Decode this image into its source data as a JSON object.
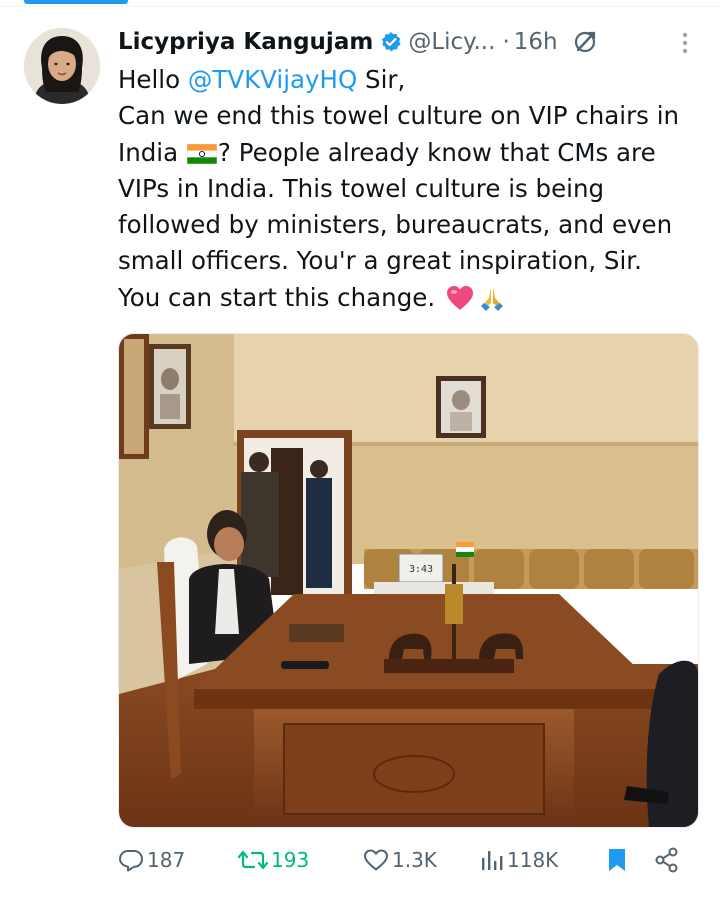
{
  "tweet": {
    "author": {
      "name": "Licypriya Kangujam",
      "handle": "@Licy...",
      "verified": true
    },
    "timestamp": "16h",
    "separator": "·",
    "text": {
      "line1_prefix": "Hello ",
      "mention": "@TVKVijayHQ",
      "line1_suffix": " Sir,",
      "line2": "Can we end this towel culture on VIP chairs in",
      "line3_prefix": "India ",
      "line3_suffix": "? People already know that CMs are",
      "line4": "VIPs in India. This towel culture is being",
      "line5": "followed by ministers, bureaucrats, and even",
      "line6": "small officers. You'r a great inspiration, Sir.",
      "line7": "You can start this change. "
    },
    "emojis": [
      "india-flag",
      "pink-heart",
      "folded-hands"
    ],
    "media": {
      "clock_display": "3:43"
    },
    "stats": {
      "replies": "187",
      "reposts": "193",
      "likes": "1.3K",
      "views": "118K"
    },
    "bookmarked": true
  },
  "colors": {
    "accent": "#1d9bf0",
    "repost": "#00ba7c",
    "muted": "#536471",
    "text": "#0f1419"
  }
}
